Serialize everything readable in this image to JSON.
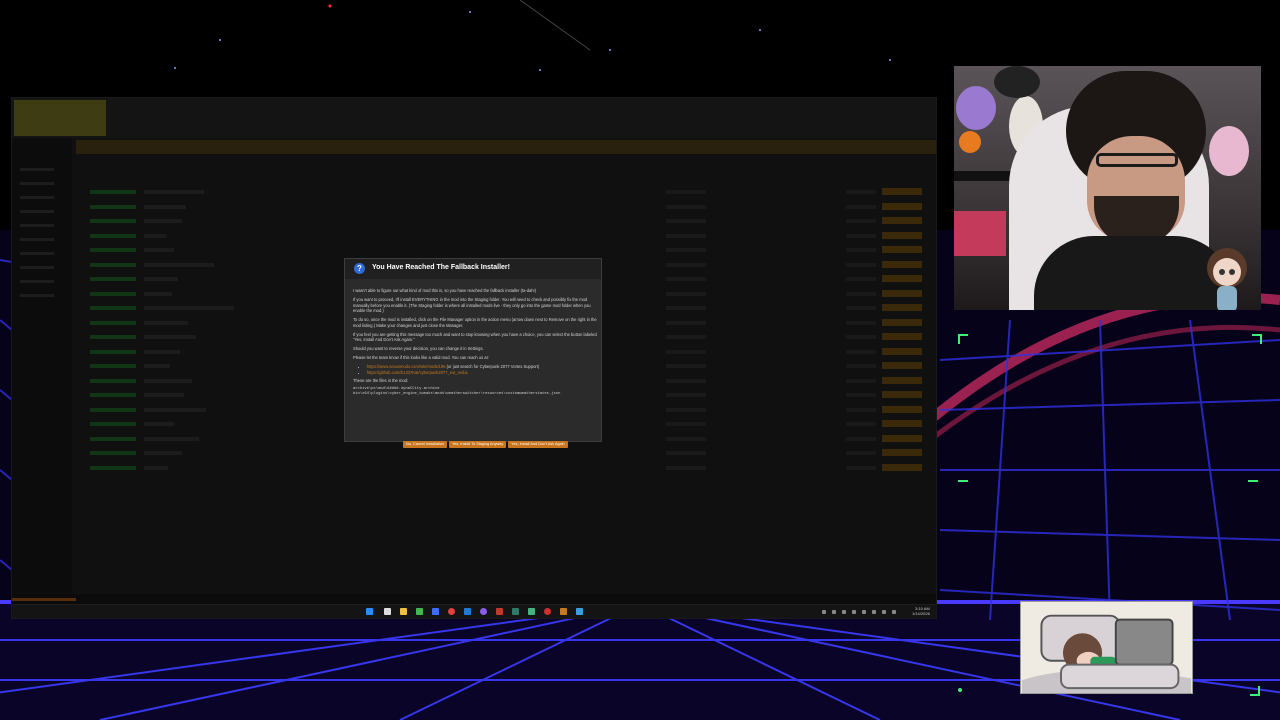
{
  "dialog": {
    "title": "You Have Reached The Fallback Installer!",
    "paragraphs": [
      "I wasn't able to figure out what kind of mod this is, so you have reached the fallback installer (ta-dah!)",
      "If you want to proceed, I'll install EVERYTHING in the mod into the Staging folder. You will need to check and possibly fix the mod manually before you enable it. (The Staging folder is where all installed mods live - they only go into the game mod folder when you enable the mod.)",
      "To do so, once the mod is installed, click on the File Manager option in the action menu (arrow down next to Remove on the right in the mod listing.) Make your changes and just close the Manager.",
      "If you feel you are getting this message too much and want to stop knowing when you have a choice, you can select the button labeled \"Yes, Install And Don't Ask Again.\"",
      "Should you want to reverse your decision, you can change it in Settings.",
      "Please let the team know if this looks like a valid mod. You can reach us at:"
    ],
    "links": [
      {
        "url": "https://www.nexusmods.com/site/mods/196",
        "suffix": " (or just search for Cyberpunk 2077 Vortex Support)"
      },
      {
        "url": "https://github.com/E1337Kat/cyberpunk2077_ext_redux",
        "suffix": ""
      }
    ],
    "files_label": "These are the files in the mod:",
    "files": [
      "archive\\pc\\mod\\#####.dynaCCity.archive",
      "bin\\x64\\plugins\\cyber_engine_tweaks\\mods\\weatherswitcher\\resources\\customweatherstates.json"
    ],
    "buttons": [
      "No, Cancel Installation",
      "Yes, Install To Staging Anyway",
      "Yes, Install And Don't Ask Again"
    ]
  },
  "taskbar": {
    "time": "3:10 AM",
    "date": "1/14/2026"
  },
  "colors": {
    "accent": "#c9751d",
    "dialog_bg": "#2b2b2b",
    "question_icon": "#2e6bd6",
    "grid_neon": "#3a3aff",
    "grid_pink": "#d2326e",
    "enabled_green": "#123516"
  },
  "icons": [
    "question-icon",
    "windows-start-icon",
    "search-icon",
    "file-explorer-icon",
    "chrome-icon",
    "discord-icon",
    "steam-icon",
    "vortex-icon",
    "obs-icon"
  ]
}
